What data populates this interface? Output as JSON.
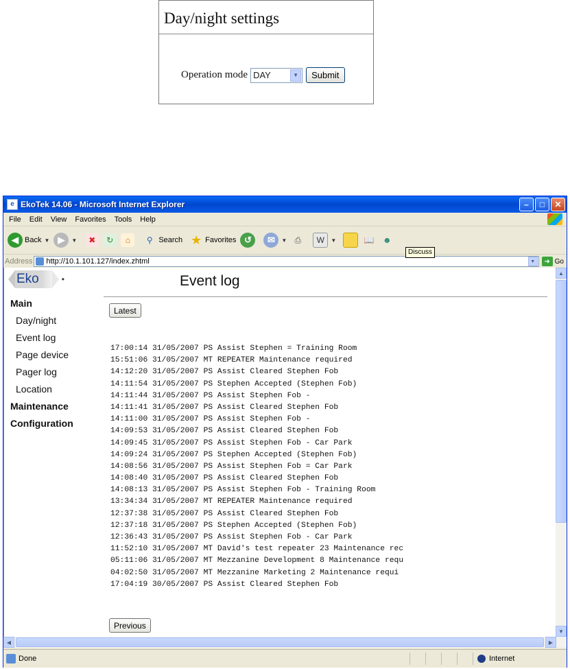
{
  "daynight": {
    "title": "Day/night settings",
    "mode_label": "Operation mode",
    "mode_value": "DAY",
    "submit_label": "Submit"
  },
  "window": {
    "title": "EkoTek 14.06 - Microsoft Internet Explorer",
    "menu": [
      "File",
      "Edit",
      "View",
      "Favorites",
      "Tools",
      "Help"
    ],
    "toolbar": {
      "back": "Back",
      "search": "Search",
      "favorites": "Favorites",
      "tooltip": "Discuss"
    },
    "address_label": "Address",
    "url": "http://10.1.101.127/index.zhtml",
    "go_label": "Go",
    "status_text": "Done",
    "zone_text": "Internet"
  },
  "page": {
    "logo_text": "Eko",
    "title": "Event log",
    "nav": {
      "main": "Main",
      "items": [
        "Day/night",
        "Event log",
        "Page device",
        "Pager log",
        "Location"
      ],
      "maintenance": "Maintenance",
      "configuration": "Configuration"
    },
    "latest_label": "Latest",
    "previous_label": "Previous",
    "events": [
      "17:00:14 31/05/2007 PS Assist Stephen = Training Room",
      "15:51:06 31/05/2007 MT REPEATER Maintenance required",
      "14:12:20 31/05/2007 PS Assist Cleared Stephen Fob",
      "14:11:54 31/05/2007 PS Stephen Accepted (Stephen Fob)",
      "14:11:44 31/05/2007 PS Assist Stephen Fob -",
      "14:11:41 31/05/2007 PS Assist Cleared Stephen Fob",
      "14:11:00 31/05/2007 PS Assist Stephen Fob -",
      "14:09:53 31/05/2007 PS Assist Cleared Stephen Fob",
      "14:09:45 31/05/2007 PS Assist Stephen Fob - Car Park",
      "14:09:24 31/05/2007 PS Stephen Accepted (Stephen Fob)",
      "14:08:56 31/05/2007 PS Assist Stephen Fob = Car Park",
      "14:08:40 31/05/2007 PS Assist Cleared Stephen Fob",
      "14:08:13 31/05/2007 PS Assist Stephen Fob - Training Room",
      "13:34:34 31/05/2007 MT REPEATER Maintenance required",
      "12:37:38 31/05/2007 PS Assist Cleared Stephen Fob",
      "12:37:18 31/05/2007 PS Stephen Accepted (Stephen Fob)",
      "12:36:43 31/05/2007 PS Assist Stephen Fob - Car Park",
      "11:52:10 31/05/2007 MT David's test repeater 23 Maintenance rec",
      "05:11:06 31/05/2007 MT Mezzanine Development 8 Maintenance requ",
      "04:02:50 31/05/2007 MT Mezzanine Marketing 2 Maintenance requi",
      "17:04:19 30/05/2007 PS Assist Cleared Stephen Fob"
    ]
  }
}
